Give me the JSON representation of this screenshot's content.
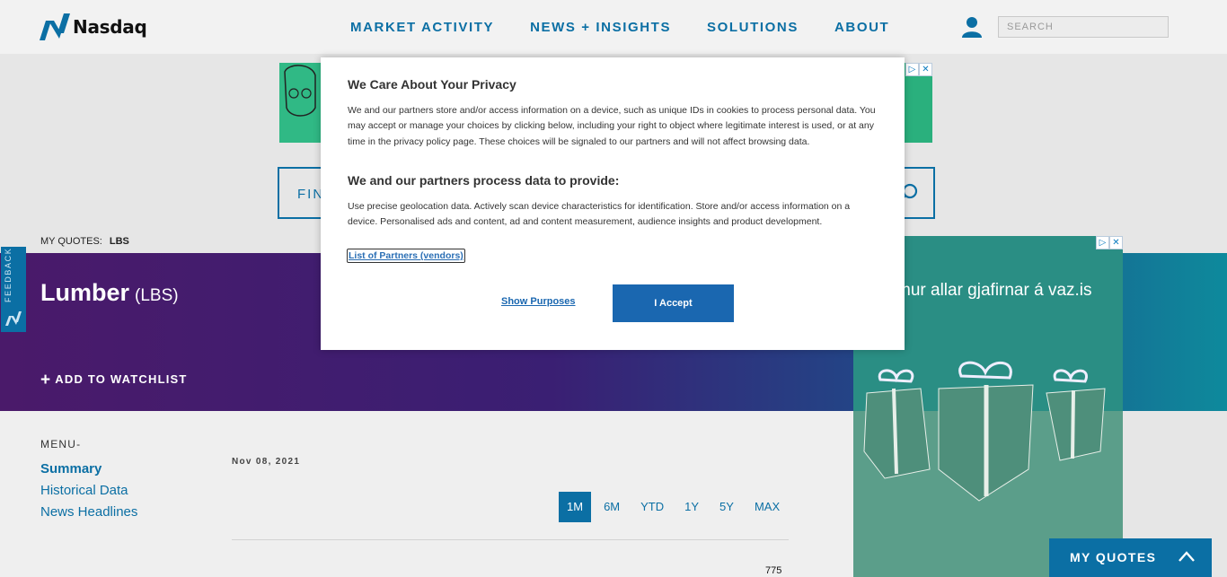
{
  "header": {
    "brand": "Nasdaq",
    "nav": [
      "MARKET ACTIVITY",
      "NEWS + INSIGHTS",
      "SOLUTIONS",
      "ABOUT"
    ],
    "search_placeholder": "SEARCH"
  },
  "find_bar": {
    "text": "FIN"
  },
  "my_quotes": {
    "label": "MY QUOTES:",
    "symbol": "LBS"
  },
  "hero": {
    "title": "Lumber",
    "symbol": "(LBS)",
    "watchlist": "ADD TO WATCHLIST"
  },
  "feedback": {
    "label": "FEEDBACK"
  },
  "menu": {
    "label": "MENU-",
    "items": [
      "Summary",
      "Historical Data",
      "News Headlines"
    ]
  },
  "chart": {
    "date": "Nov 08, 2021",
    "ranges": [
      "1M",
      "6M",
      "YTD",
      "1Y",
      "5Y",
      "MAX"
    ],
    "active_range": "1M",
    "y_label": "775"
  },
  "right_ad": {
    "text": "mur allar gjafirnar á vaz.is"
  },
  "my_quotes_bar": {
    "label": "MY QUOTES"
  },
  "privacy": {
    "title": "We Care About Your Privacy",
    "p1": "We and our partners store and/or access information on a device, such as unique IDs in cookies to process personal data. You may accept or manage your choices by clicking below, including your right to object where legitimate interest is used, or at any time in the privacy policy page. These choices will be signaled to our partners and will not affect browsing data.",
    "subtitle": "We and our partners process data to provide:",
    "p2": "Use precise geolocation data. Actively scan device characteristics for identification. Store and/or access information on a device. Personalised ads and content, ad and content measurement, audience insights and product development.",
    "partners_link": "List of Partners (vendors)",
    "show_purposes": "Show Purposes",
    "accept": "I Accept"
  },
  "colors": {
    "brand": "#0b6fa4",
    "accept": "#1a67b0"
  }
}
